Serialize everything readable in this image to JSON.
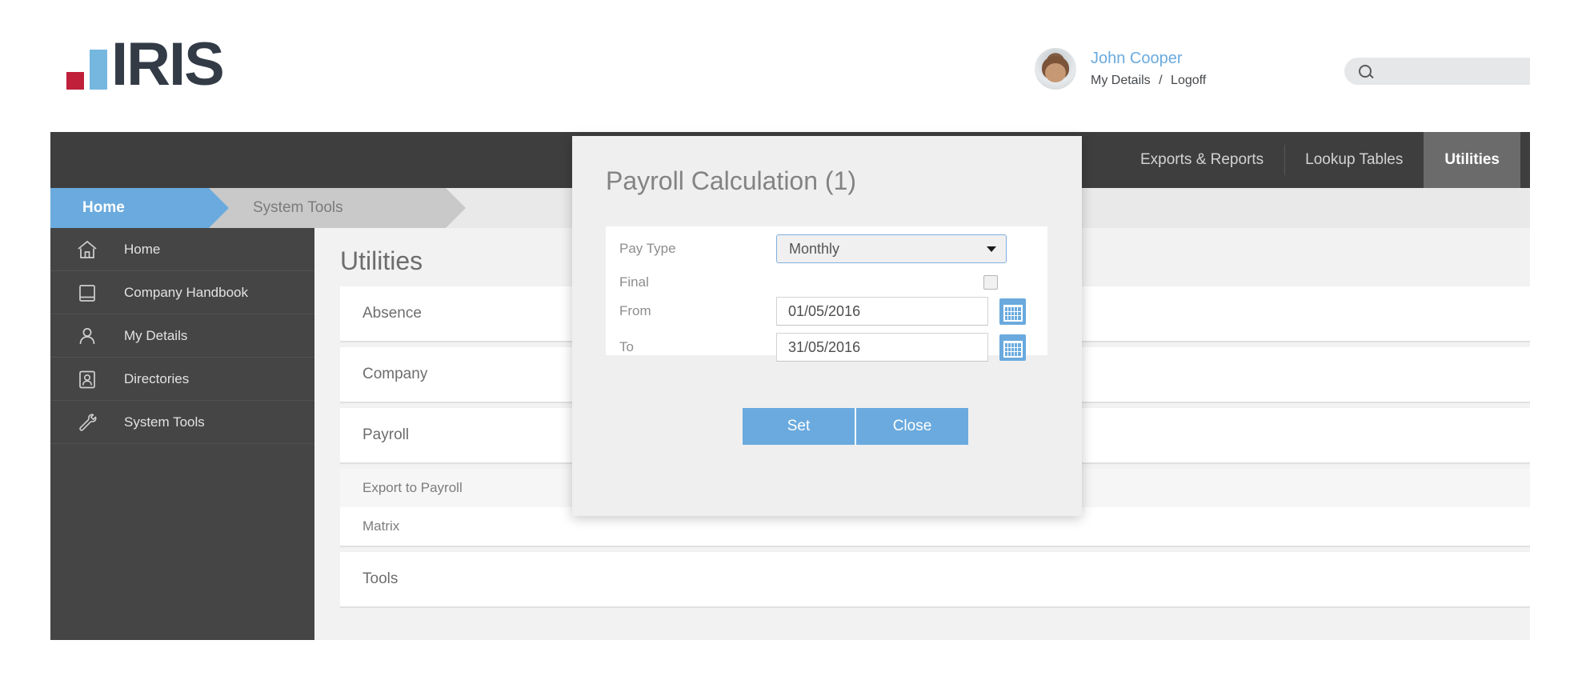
{
  "header": {
    "logo_text": "IRIS",
    "user": {
      "name": "John Cooper",
      "details_link": "My Details",
      "separator": "/",
      "logoff_link": "Logoff"
    },
    "search": {
      "value": "",
      "placeholder": ""
    }
  },
  "nav": {
    "items": [
      {
        "label": "Exports & Reports",
        "active": false
      },
      {
        "label": "Lookup Tables",
        "active": false
      },
      {
        "label": "Utilities",
        "active": true
      }
    ]
  },
  "breadcrumb": {
    "items": [
      {
        "label": "Home",
        "active": true
      },
      {
        "label": "System Tools",
        "active": false
      }
    ]
  },
  "sidebar": {
    "items": [
      {
        "label": "Home",
        "icon": "home-icon"
      },
      {
        "label": "Company Handbook",
        "icon": "book-icon"
      },
      {
        "label": "My Details",
        "icon": "person-icon"
      },
      {
        "label": "Directories",
        "icon": "id-card-icon"
      },
      {
        "label": "System Tools",
        "icon": "wrench-icon"
      }
    ]
  },
  "main": {
    "title": "Utilities",
    "cards": [
      {
        "label": "Absence"
      },
      {
        "label": "Company"
      },
      {
        "label": "Payroll"
      }
    ],
    "payroll_subitems": [
      {
        "label": "Export to Payroll",
        "highlight": true
      },
      {
        "label": "Matrix",
        "highlight": false
      }
    ],
    "tools_card": {
      "label": "Tools"
    }
  },
  "modal": {
    "title": "Payroll Calculation (1)",
    "fields": {
      "pay_type": {
        "label": "Pay Type",
        "value": "Monthly"
      },
      "final": {
        "label": "Final",
        "checked": false
      },
      "from": {
        "label": "From",
        "value": "01/05/2016"
      },
      "to": {
        "label": "To",
        "value": "31/05/2016"
      }
    },
    "buttons": {
      "set": "Set",
      "close": "Close"
    }
  },
  "colors": {
    "accent_blue": "#6aaade",
    "nav_dark": "#3e3e3e",
    "nav_active": "#6b6b6b",
    "sidebar": "#454545",
    "logo_red": "#c0203a",
    "logo_blue": "#76b7e0",
    "logo_navy": "#333b47",
    "page_bg": "#f2f2f2"
  }
}
